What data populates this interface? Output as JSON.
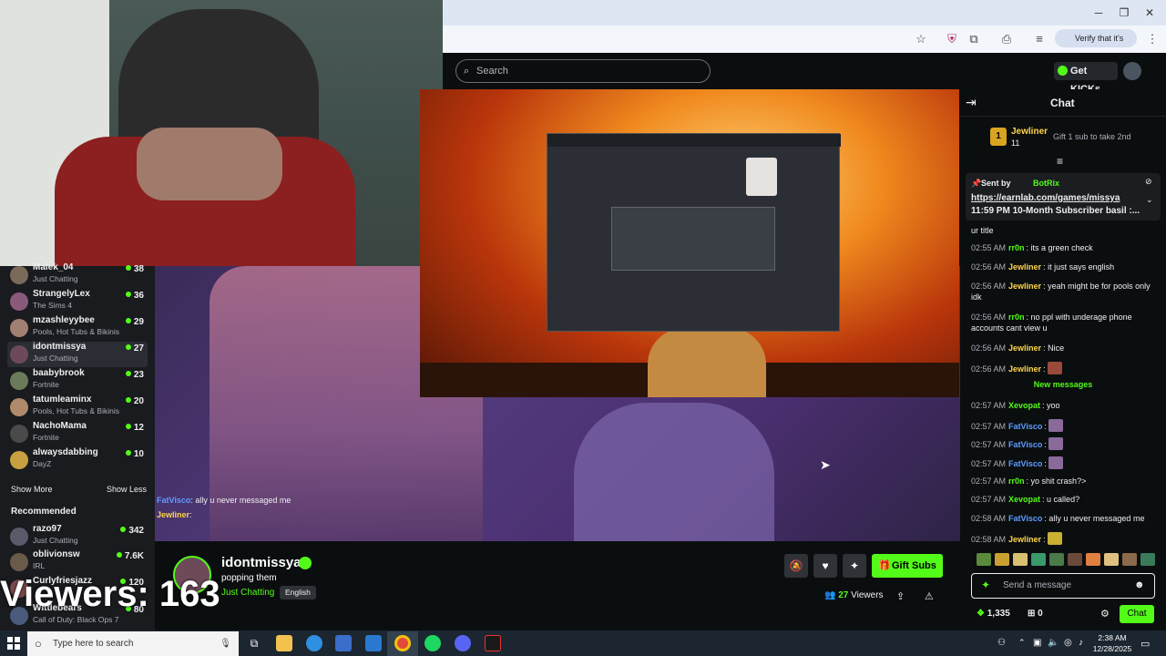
{
  "browser": {
    "verify_text": "Verify that it's you"
  },
  "header": {
    "search_placeholder": "Search",
    "get_kicks_label": "Get KICKs"
  },
  "sidebar": {
    "channels": [
      {
        "name": "Malek_04",
        "category": "Just Chatting",
        "viewers": "38",
        "avatar_color": "#7a6a5a"
      },
      {
        "name": "StrangelyLex",
        "category": "The Sims 4",
        "viewers": "36",
        "avatar_color": "#8a5a7a"
      },
      {
        "name": "mzashleyybee",
        "category": "Pools, Hot Tubs & Bikinis",
        "viewers": "29",
        "avatar_color": "#a08070"
      },
      {
        "name": "idontmissya",
        "category": "Just Chatting",
        "viewers": "27",
        "avatar_color": "#6d4a5a"
      },
      {
        "name": "baabybrook",
        "category": "Fortnite",
        "viewers": "23",
        "avatar_color": "#6a7a5a"
      },
      {
        "name": "tatumleaminx",
        "category": "Pools, Hot Tubs & Bikinis",
        "viewers": "20",
        "avatar_color": "#b08a6a"
      },
      {
        "name": "NachoMama",
        "category": "Fortnite",
        "viewers": "12",
        "avatar_color": "#4a4a4a"
      },
      {
        "name": "alwaysdabbing",
        "category": "DayZ",
        "viewers": "10",
        "avatar_color": "#c8a040"
      }
    ],
    "show_more": "Show More",
    "show_less": "Show Less",
    "recommended_label": "Recommended",
    "recommended": [
      {
        "name": "razo97",
        "category": "Just Chatting",
        "viewers": "342",
        "avatar_color": "#5a5a6a"
      },
      {
        "name": "oblivionsw",
        "category": "IRL",
        "viewers": "7.6K",
        "avatar_color": "#6a5a4a"
      },
      {
        "name": "Curlyfriesjazz",
        "category": "",
        "viewers": "120",
        "avatar_color": "#7a4a4a"
      },
      {
        "name": "Wittlebears",
        "category": "Call of Duty: Black Ops 7",
        "viewers": "80",
        "avatar_color": "#4a5a7a"
      }
    ]
  },
  "overlay": {
    "big_viewers": "Viewers: 163",
    "chat_1_user": "FatVisco",
    "chat_1_text": ": ally u never messaged me",
    "chat_2_user": "Jewliner",
    "chat_2_text": ":"
  },
  "stream": {
    "streamer": "idontmissya",
    "title": "popping them",
    "category": "Just Chatting",
    "language": "English",
    "viewers": "27",
    "viewers_label": "Viewers",
    "gift_subs_label": "Gift Subs"
  },
  "chat": {
    "title": "Chat",
    "top_gifter": "Jewliner",
    "top_gifter_count": "11",
    "gift_prompt": "Gift 1 sub to take 2nd",
    "pinned_by_label": "Sent by",
    "pinned_by_user": "BotRix",
    "pinned_link": "https://earnlab.com/games/missya",
    "pinned_text": "11:59 PM 10-Month Subscriber basil :...",
    "messages": [
      {
        "time": "",
        "user": "",
        "text": "ur title",
        "color": "green"
      },
      {
        "time": "02:55 AM",
        "user": "rr0n",
        "text": ": its a green check",
        "color": "green"
      },
      {
        "time": "02:56 AM",
        "user": "Jewliner",
        "text": ": it just says english",
        "color": "yellow"
      },
      {
        "time": "02:56 AM",
        "user": "Jewliner",
        "text": ": yeah might be for pools only idk",
        "color": "yellow"
      },
      {
        "time": "02:56 AM",
        "user": "rr0n",
        "text": ": no ppl with underage phone accounts cant view u",
        "color": "green"
      },
      {
        "time": "02:56 AM",
        "user": "Jewliner",
        "text": ": Nice",
        "color": "yellow"
      },
      {
        "time": "02:56 AM",
        "user": "Jewliner",
        "text": ":",
        "color": "yellow"
      }
    ],
    "new_messages_label": "New messages",
    "new_messages": [
      {
        "time": "02:57 AM",
        "user": "Xevopat",
        "text": ": yoo",
        "color": "green"
      },
      {
        "time": "02:57 AM",
        "user": "FatVisco",
        "text": ":",
        "color": "blue"
      },
      {
        "time": "02:57 AM",
        "user": "FatVisco",
        "text": ":",
        "color": "blue"
      },
      {
        "time": "02:57 AM",
        "user": "FatVisco",
        "text": ":",
        "color": "blue"
      },
      {
        "time": "02:57 AM",
        "user": "rr0n",
        "text": ": yo shit crash?>",
        "color": "green"
      },
      {
        "time": "02:57 AM",
        "user": "Xevopat",
        "text": ": u called?",
        "color": "green"
      },
      {
        "time": "02:58 AM",
        "user": "FatVisco",
        "text": ": ally u never messaged me",
        "color": "blue"
      },
      {
        "time": "02:58 AM",
        "user": "Jewliner",
        "text": ":",
        "color": "yellow"
      }
    ],
    "send_placeholder": "Send a message",
    "points": "1,335",
    "badge_count": "0",
    "chat_button": "Chat"
  },
  "taskbar": {
    "search_placeholder": "Type here to search",
    "time": "2:38 AM",
    "date": "12/28/2025"
  }
}
